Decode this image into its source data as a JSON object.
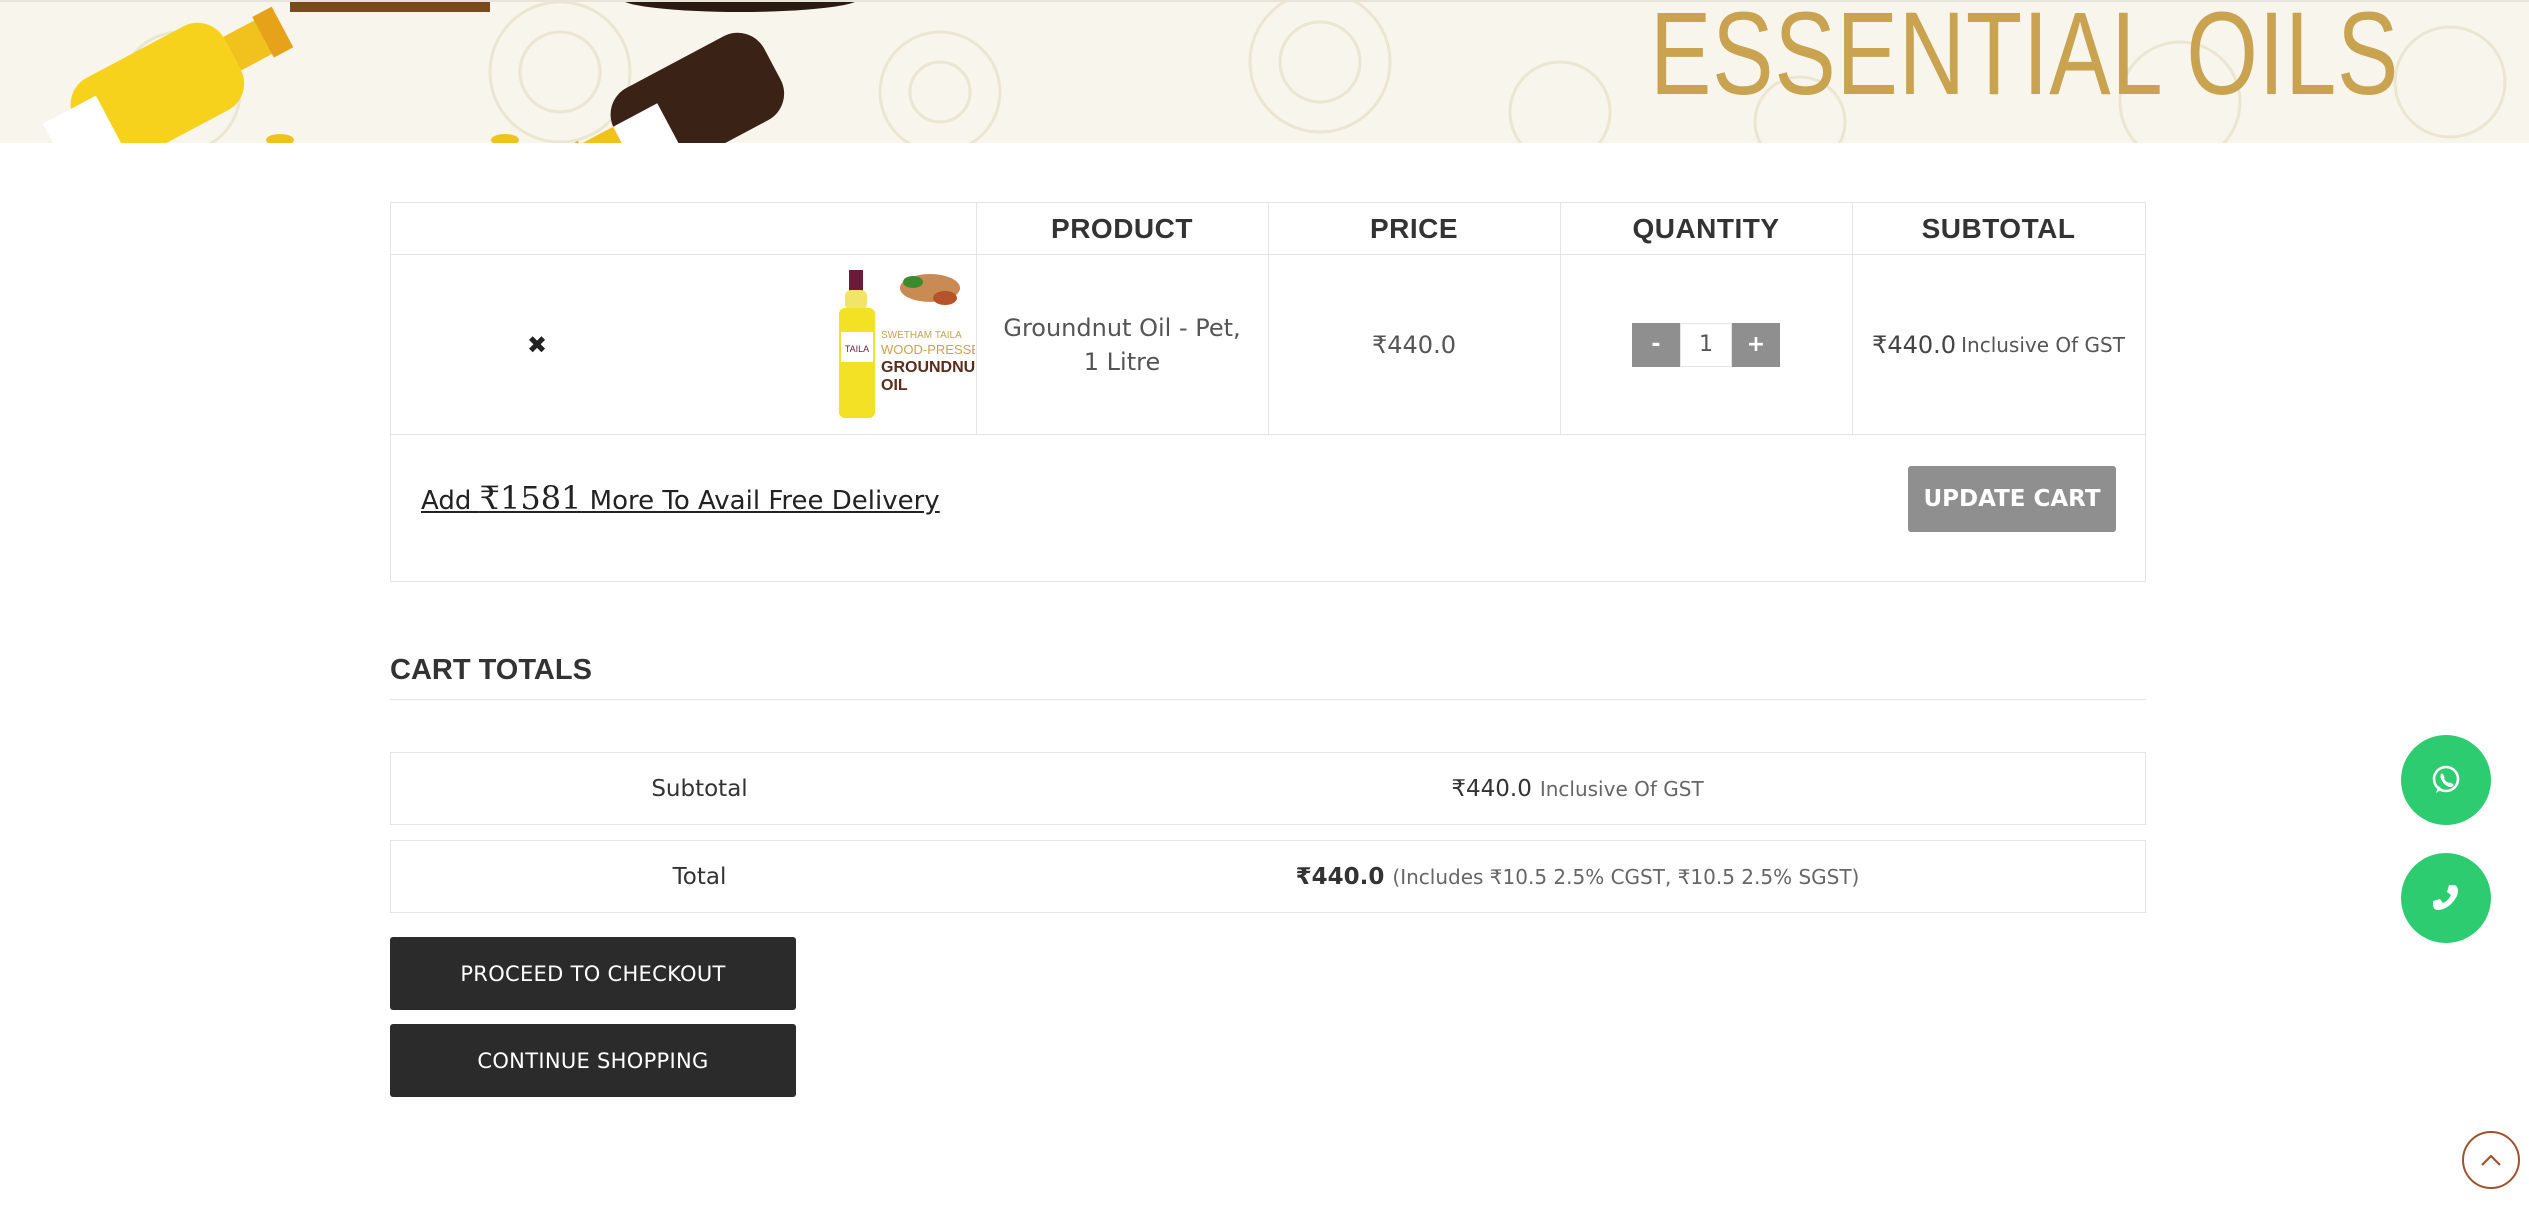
{
  "banner": {
    "title": "ESSENTIAL OILS",
    "title_color": "#c9a34f"
  },
  "cart": {
    "headers": {
      "product": "PRODUCT",
      "price": "PRICE",
      "quantity": "QUANTITY",
      "subtotal": "SUBTOTAL"
    },
    "items": [
      {
        "remove_icon": "close-icon",
        "image_text": {
          "line1": "SWETHAM TAILA",
          "line2": "WOOD-PRESSED",
          "line3": "GROUNDNUT",
          "line4": "OIL"
        },
        "name": "Groundnut Oil - Pet, 1 Litre",
        "price": "₹440.0",
        "quantity_minus": "-",
        "quantity": "1",
        "quantity_plus": "+",
        "subtotal": "₹440.0",
        "subtotal_note": "Inclusive Of GST"
      }
    ],
    "free_delivery": {
      "prefix": "Add ",
      "amount": "₹1581",
      "suffix": " More To Avail Free Delivery"
    },
    "update_button": "UPDATE CART"
  },
  "totals": {
    "title": "CART TOTALS",
    "subtotal_label": "Subtotal",
    "subtotal_value": "₹440.0",
    "subtotal_note": "Inclusive Of GST",
    "total_label": "Total",
    "total_value": "₹440.0",
    "total_note": "(Includes ₹10.5 2.5% CGST, ₹10.5 2.5% SGST)",
    "checkout_button": "PROCEED TO CHECKOUT",
    "continue_button": "CONTINUE SHOPPING"
  },
  "floating": {
    "whatsapp_icon": "whatsapp-icon",
    "phone_icon": "phone-icon",
    "scroll_top_icon": "chevron-up-icon",
    "accent": "#2ecc71"
  },
  "colors": {
    "dark_button": "#2b2b2b",
    "grey_button": "#8f8f8f",
    "border": "#e5e5e5"
  }
}
